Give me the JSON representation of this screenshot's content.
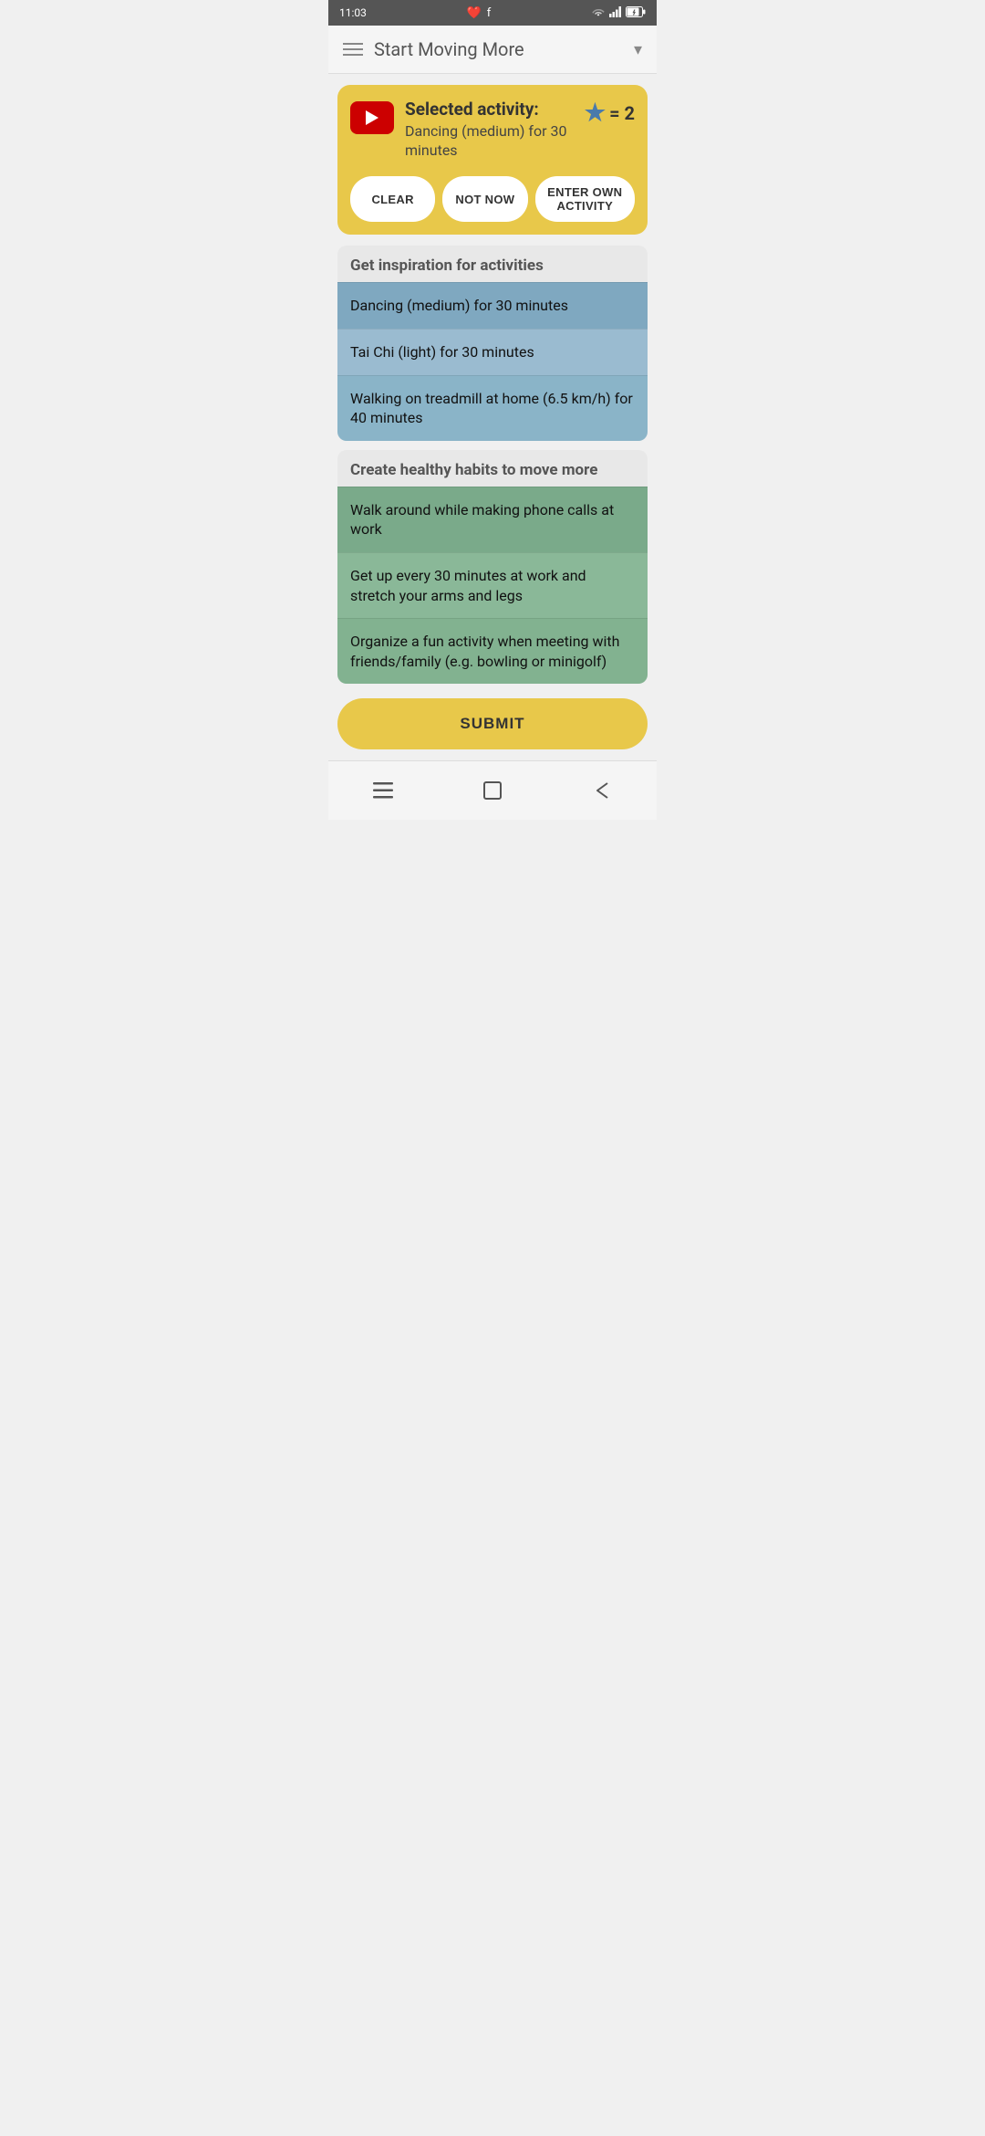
{
  "statusBar": {
    "time": "11:03",
    "wifi": true,
    "battery": true
  },
  "header": {
    "title": "Start Moving More",
    "menuLabel": "menu",
    "dropdownLabel": "dropdown"
  },
  "activityCard": {
    "label": "Selected activity:",
    "description": "Dancing (medium) for 30 minutes",
    "starLabel": "= 2",
    "buttons": {
      "clear": "CLEAR",
      "notNow": "NOT NOW",
      "enterOwn": "ENTER OWN ACTIVITY"
    }
  },
  "inspirationSection": {
    "header": "Get inspiration for activities",
    "items": [
      "Dancing (medium) for 30 minutes",
      "Tai Chi (light) for 30 minutes",
      "Walking on treadmill at home (6.5 km/h) for 40 minutes"
    ]
  },
  "habitsSection": {
    "header": "Create healthy habits to move more",
    "items": [
      "Walk around while making phone calls at work",
      "Get up every 30 minutes at work and stretch your arms and legs",
      "Organize a fun activity when meeting with friends/family (e.g. bowling or minigolf)"
    ]
  },
  "submitButton": "SUBMIT",
  "navBar": {
    "menu": "≡",
    "home": "□",
    "back": "◁"
  }
}
